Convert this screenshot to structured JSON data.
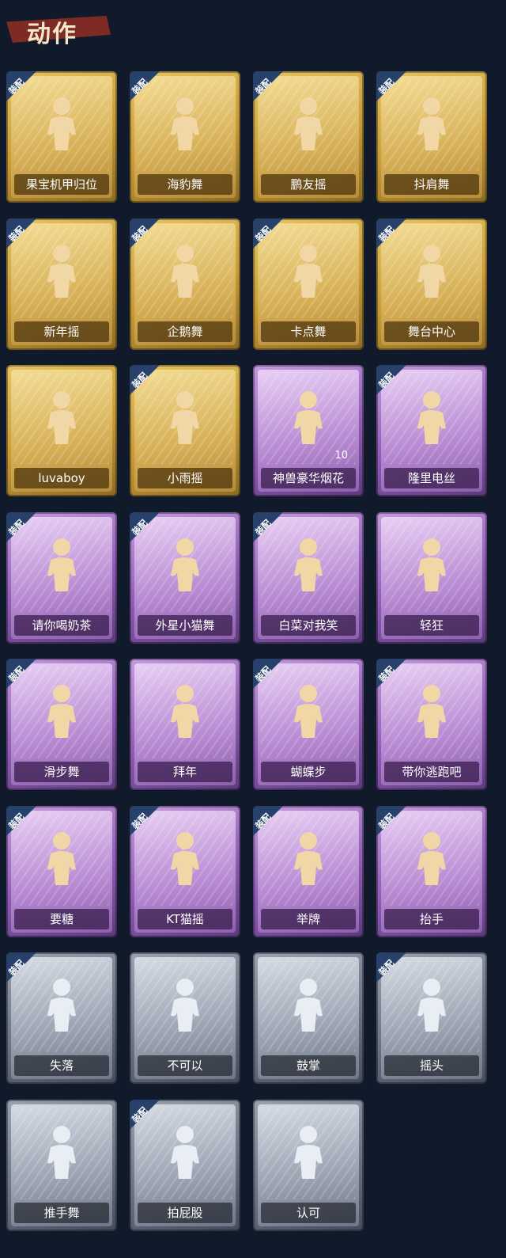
{
  "header": {
    "title": "动作"
  },
  "equip_badge": "装配",
  "cards": [
    {
      "label": "果宝机甲归位",
      "tier": "gold",
      "equipped": true,
      "icon": "dance-pose-icon"
    },
    {
      "label": "海豹舞",
      "tier": "gold",
      "equipped": true,
      "icon": "dance-pose-icon"
    },
    {
      "label": "鹏友摇",
      "tier": "gold",
      "equipped": true,
      "icon": "dance-pose-icon"
    },
    {
      "label": "抖肩舞",
      "tier": "gold",
      "equipped": true,
      "icon": "dance-pose-icon"
    },
    {
      "label": "新年摇",
      "tier": "gold",
      "equipped": true,
      "icon": "dance-pose-icon"
    },
    {
      "label": "企鹅舞",
      "tier": "gold",
      "equipped": true,
      "icon": "dance-pose-icon"
    },
    {
      "label": "卡点舞",
      "tier": "gold",
      "equipped": true,
      "icon": "dance-pose-icon"
    },
    {
      "label": "舞台中心",
      "tier": "gold",
      "equipped": true,
      "icon": "dance-pose-icon"
    },
    {
      "label": "luvaboy",
      "tier": "gold",
      "equipped": false,
      "icon": "dance-pose-icon"
    },
    {
      "label": "小雨摇",
      "tier": "gold",
      "equipped": true,
      "icon": "dance-pose-icon"
    },
    {
      "label": "神兽豪华烟花",
      "tier": "purple",
      "equipped": false,
      "icon": "fireworks-icon",
      "count": "10"
    },
    {
      "label": "隆里电丝",
      "tier": "purple",
      "equipped": true,
      "icon": "dance-pose-icon"
    },
    {
      "label": "请你喝奶茶",
      "tier": "purple",
      "equipped": true,
      "icon": "milk-tea-pose-icon"
    },
    {
      "label": "外星小猫舞",
      "tier": "purple",
      "equipped": true,
      "icon": "dance-pose-icon"
    },
    {
      "label": "白菜对我笑",
      "tier": "purple",
      "equipped": true,
      "icon": "dance-pose-icon"
    },
    {
      "label": "轻狂",
      "tier": "purple",
      "equipped": false,
      "icon": "character-portrait-icon"
    },
    {
      "label": "滑步舞",
      "tier": "purple",
      "equipped": true,
      "icon": "dance-pose-icon"
    },
    {
      "label": "拜年",
      "tier": "purple",
      "equipped": false,
      "icon": "bow-pose-icon"
    },
    {
      "label": "蝴蝶步",
      "tier": "purple",
      "equipped": true,
      "icon": "dance-pose-icon"
    },
    {
      "label": "带你逃跑吧",
      "tier": "purple",
      "equipped": true,
      "icon": "dance-pose-icon"
    },
    {
      "label": "要糖",
      "tier": "purple",
      "equipped": true,
      "icon": "reach-pose-icon"
    },
    {
      "label": "KT猫摇",
      "tier": "purple",
      "equipped": true,
      "icon": "dance-pose-icon"
    },
    {
      "label": "举牌",
      "tier": "purple",
      "equipped": true,
      "icon": "sign-pose-icon"
    },
    {
      "label": "抬手",
      "tier": "purple",
      "equipped": true,
      "icon": "raise-hand-pose-icon"
    },
    {
      "label": "失落",
      "tier": "grey",
      "equipped": true,
      "icon": "crawl-pose-icon"
    },
    {
      "label": "不可以",
      "tier": "grey",
      "equipped": false,
      "icon": "finger-wag-icon"
    },
    {
      "label": "鼓掌",
      "tier": "grey",
      "equipped": false,
      "icon": "clap-icon"
    },
    {
      "label": "摇头",
      "tier": "grey",
      "equipped": true,
      "icon": "shake-head-icon"
    },
    {
      "label": "推手舞",
      "tier": "grey",
      "equipped": false,
      "icon": "push-dance-icon"
    },
    {
      "label": "拍屁股",
      "tier": "grey",
      "equipped": true,
      "icon": "slap-pose-icon"
    },
    {
      "label": "认可",
      "tier": "grey",
      "equipped": false,
      "icon": "thumbs-up-icon"
    }
  ]
}
